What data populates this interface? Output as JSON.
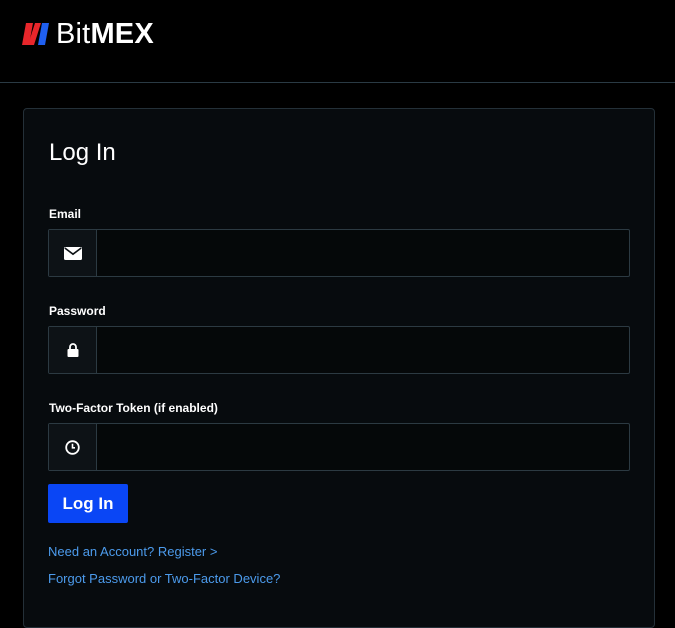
{
  "brand": {
    "name_light": "Bit",
    "name_bold": "MEX",
    "colors": {
      "red": "#e8262b",
      "blue": "#1f5ff0"
    }
  },
  "login": {
    "title": "Log In",
    "email": {
      "label": "Email",
      "value": "",
      "placeholder": "",
      "icon": "envelope-icon"
    },
    "password": {
      "label": "Password",
      "value": "",
      "placeholder": "",
      "icon": "lock-icon"
    },
    "two_factor": {
      "label": "Two-Factor Token (if enabled)",
      "value": "",
      "placeholder": "",
      "icon": "clock-icon"
    },
    "submit_label": "Log In",
    "register_link": "Need an Account? Register >",
    "forgot_link": "Forgot Password or Two-Factor Device?"
  },
  "colors": {
    "accent_button": "#0a46f5",
    "link": "#4c9bec",
    "background": "#000000",
    "panel": "#070b0e"
  }
}
